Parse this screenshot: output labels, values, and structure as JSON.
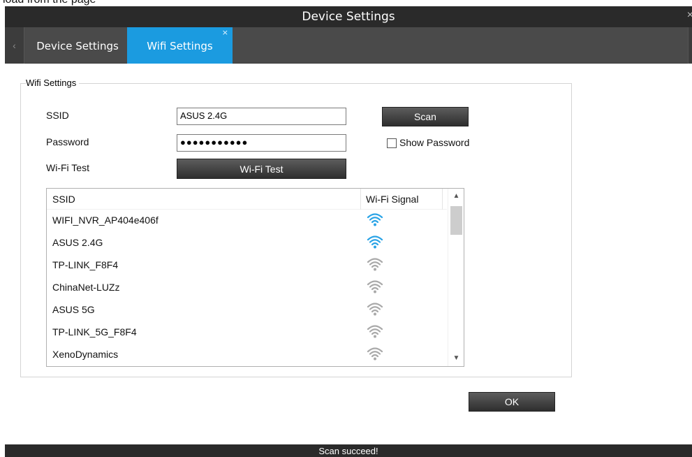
{
  "fragment": {
    "text": "load from the page"
  },
  "window": {
    "title": "Device Settings",
    "close_glyph": "×"
  },
  "tabs": {
    "left_arrow": "‹",
    "items": [
      {
        "label": "Device Settings",
        "active": false
      },
      {
        "label": "Wifi Settings",
        "active": true,
        "close_glyph": "×"
      }
    ],
    "active_color": "#1b9be0"
  },
  "wifi": {
    "group_label": "Wifi Settings",
    "ssid_label": "SSID",
    "ssid_value": "ASUS 2.4G",
    "password_label": "Password",
    "password_value": "●●●●●●●●●●●",
    "wifi_test_label": "Wi-Fi Test",
    "scan_button": "Scan",
    "show_password_label": "Show Password",
    "show_password_checked": false,
    "wifi_test_button": "Wi-Fi Test"
  },
  "network_list": {
    "columns": {
      "ssid": "SSID",
      "signal": "Wi-Fi Signal"
    },
    "rows": [
      {
        "ssid": "WIFI_NVR_AP404e406f",
        "signal_icon": "wifi-icon",
        "strong": true
      },
      {
        "ssid": "ASUS 2.4G",
        "signal_icon": "wifi-icon",
        "strong": true
      },
      {
        "ssid": "TP-LINK_F8F4",
        "signal_icon": "wifi-icon",
        "strong": false
      },
      {
        "ssid": "ChinaNet-LUZz",
        "signal_icon": "wifi-icon",
        "strong": false
      },
      {
        "ssid": "ASUS 5G",
        "signal_icon": "wifi-icon",
        "strong": false
      },
      {
        "ssid": "TP-LINK_5G_F8F4",
        "signal_icon": "wifi-icon",
        "strong": false
      },
      {
        "ssid": "XenoDynamics",
        "signal_icon": "wifi-icon",
        "strong": false
      }
    ],
    "signal_colors": {
      "strong": "#29a3e6",
      "weak": "#a9a9a9"
    },
    "scroll_up_glyph": "▲",
    "scroll_down_glyph": "▼"
  },
  "footer": {
    "ok_button": "OK"
  },
  "status": {
    "message": "Scan succeed!"
  }
}
